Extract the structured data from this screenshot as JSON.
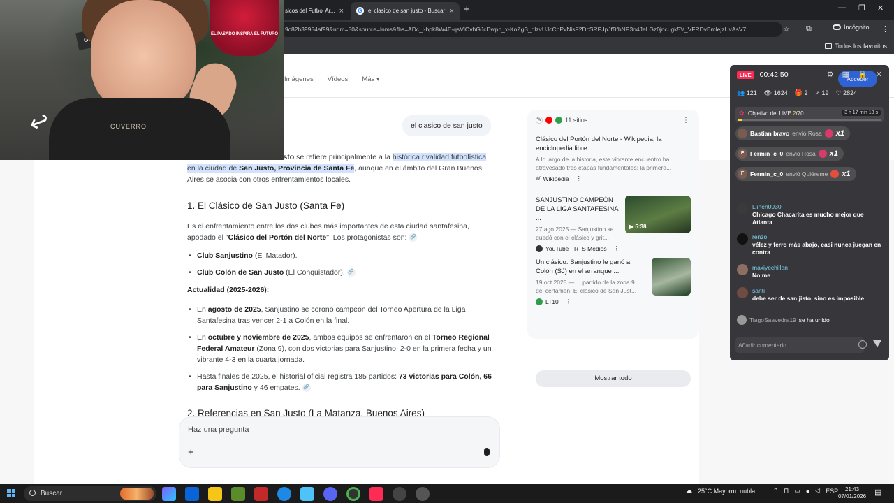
{
  "browser": {
    "tabs": [
      {
        "label": "sicos del Futbol Ar...",
        "active": false
      },
      {
        "label": "el clasico de san justo - Buscar",
        "active": true
      }
    ],
    "url": "9c82b39954af99&udm=50&source=lnms&fbs=ADc_l-bpk8W4E-qsVlOvbGJcDwpn_x-KoZgS_dlzvUJcCpPvNisF2DcSRPJpJfBfbNP3o4JeLGz0jncugk5V_VFRDvEmlejzUvAsV7...",
    "incognito_label": "Incógnito",
    "favorites_label": "Todos los favoritos"
  },
  "search": {
    "nav_tabs": [
      "Imágenes",
      "Vídeos",
      "Más"
    ],
    "query": "el clasico de san justo",
    "intro_pre": "usto",
    "intro_mid1": " se refiere principalmente a la ",
    "intro_hl1": "histórica rivalidad futbolística en la ciudad de ",
    "intro_hl2": "San Justo, Provincia de Santa Fe",
    "intro_post": ", aunque en el ámbito del Gran Buenos Aires se asocia con otros enfrentamientos locales.",
    "h1": "1. El Clásico de San Justo (Santa Fe)",
    "p1_pre": "Es el enfrentamiento entre los dos clubes más importantes de esta ciudad santafesina, apodado el \"",
    "p1_bold": "Clásico del Portón del Norte",
    "p1_post": "\". Los protagonistas son:",
    "club1_b": "Club Sanjustino",
    "club1_r": " (El Matador).",
    "club2_b": "Club Colón de San Justo",
    "club2_r": " (El Conquistador).",
    "actualidad": "Actualidad (2025-2026):",
    "b1_pre": "En ",
    "b1_bold": "agosto de 2025",
    "b1_post": ", Sanjustino se coronó campeón del Torneo Apertura de la Liga Santafesina tras vencer 2-1 a Colón en la final.",
    "b2_pre": "En ",
    "b2_bold": "octubre y noviembre de 2025",
    "b2_mid": ", ambos equipos se enfrentaron en el ",
    "b2_bold2": "Torneo Regional Federal Amateur",
    "b2_post": " (Zona 9), con dos victorias para Sanjustino: 2-0 en la primera fecha y un vibrante 4-3 en la cuarta jornada.",
    "b3_pre": "Hasta finales de 2025, el historial oficial registra 185 partidos: ",
    "b3_bold": "73 victorias para Colón, 66 para Sanjustino",
    "b3_post": " y 46 empates.",
    "h2": "2. Referencias en San Justo (La Matanza, Buenos Aires)",
    "ask_placeholder": "Haz una pregunta"
  },
  "sources": {
    "count_label": "11 sitios",
    "items": [
      {
        "title": "Clásico del Portón del Norte - Wikipedia, la enciclopedia libre",
        "snippet": "A lo largo de la historia, este vibrante encuentro ha atravesado tres etapas fundamentales: la primera...",
        "site": "Wikipedia"
      },
      {
        "title": "SANJUSTINO CAMPEÓN DE LA LIGA SANTAFESINA ...",
        "snippet": "27 ago 2025 — Sanjustino se quedó con el clásico y grit...",
        "site": "YouTube · RTS Medios",
        "duration": "5:38"
      },
      {
        "title": "Un clásico: Sanjustino le ganó a Colón (SJ) en el arranque ...",
        "snippet": "19 oct 2025 — ... partido de la zona 9 del certamen. El clásico de San Just...",
        "site": "LT10"
      }
    ],
    "show_all": "Mostrar todo"
  },
  "webcam": {
    "poster_text": "GOOD GAME",
    "badge_text": "EL PASADO INSPIRA EL FUTURO",
    "shirt_text": "CUVERRO"
  },
  "live": {
    "badge": "LIVE",
    "timer": "00:42:50",
    "button_label": "Acceder",
    "stats": {
      "viewers": "121",
      "views": "1624",
      "gifts": "2",
      "shares": "19",
      "likes": "2824"
    },
    "goal": {
      "label": "Objetivo del LIVE ",
      "current": "2",
      "total": "/70",
      "time": "3 h 17 min 18 s",
      "progress": 0.03
    },
    "gifts": [
      {
        "user": "Bastian bravo",
        "action": " envió Rosa",
        "mult": "x1"
      },
      {
        "user": "Fermin_c_0",
        "action": " envió Rosa",
        "mult": "x1"
      },
      {
        "user": "Fermin_c_0",
        "action": " envió Quiéreme",
        "mult": "x1"
      }
    ],
    "chat": [
      {
        "user": "Lliñeñ0930",
        "message": "Chicago Chacarita es mucho mejor que Atlanta"
      },
      {
        "user": "renzo",
        "message": "vélez y ferro más abajo, casi nunca juegan en contra"
      },
      {
        "user": "maxiyechillan",
        "message": "No me"
      },
      {
        "user": "santi",
        "message": "debe ser de san jisto, sino es imposible"
      }
    ],
    "joined_user": "TiagoSaavedra19",
    "joined_text": "se ha unido",
    "comment_placeholder": "Añadir comentario"
  },
  "taskbar": {
    "search": "Buscar",
    "weather": "25°C  Mayorm. nubla...",
    "lang": "ESP",
    "time": "21:43",
    "date": "07/01/2026"
  }
}
